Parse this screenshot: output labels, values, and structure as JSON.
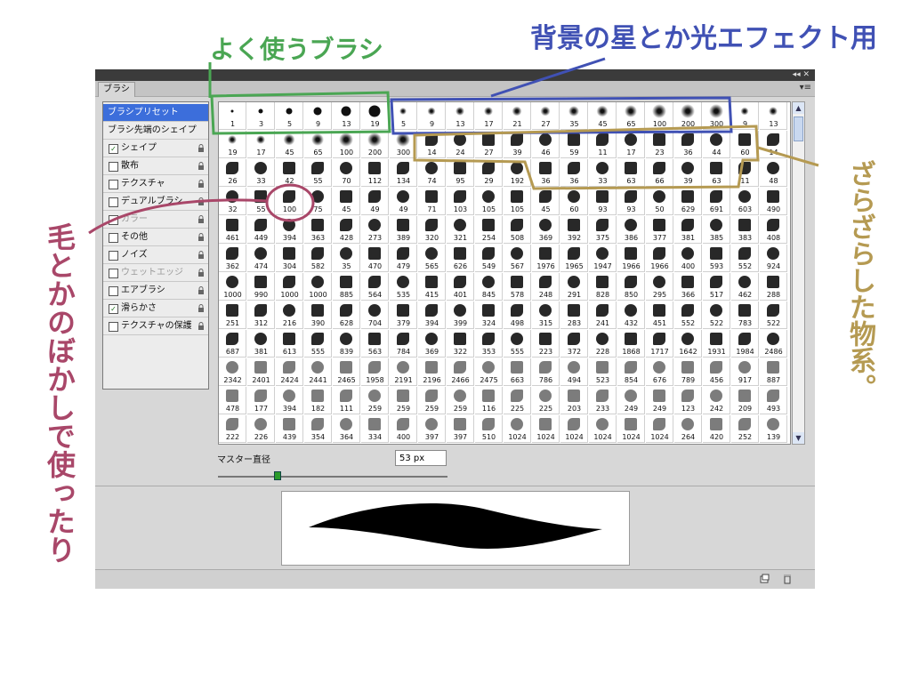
{
  "panel": {
    "tab_label": "ブラシ",
    "title_controls": "◂◂ ✕",
    "panel_menu": "▾≡"
  },
  "sidebar": {
    "items": [
      {
        "label": "ブラシプリセット",
        "kind": "selected"
      },
      {
        "label": "ブラシ先端のシェイプ",
        "kind": "head"
      },
      {
        "label": "シェイプ",
        "checked": true,
        "lock": true
      },
      {
        "label": "散布",
        "checked": false,
        "lock": true
      },
      {
        "label": "テクスチャ",
        "checked": false,
        "lock": true
      },
      {
        "label": "デュアルブラシ",
        "checked": false,
        "lock": true
      },
      {
        "label": "カラー",
        "checked": false,
        "lock": true,
        "disabled": true
      },
      {
        "label": "その他",
        "checked": false,
        "lock": true
      },
      {
        "label": "ノイズ",
        "checked": false,
        "lock": true
      },
      {
        "label": "ウェットエッジ",
        "checked": false,
        "lock": true,
        "disabled": true
      },
      {
        "label": "エアブラシ",
        "checked": false,
        "lock": true
      },
      {
        "label": "滑らかさ",
        "checked": true,
        "lock": true
      },
      {
        "label": "テクスチャの保護",
        "checked": false,
        "lock": true
      }
    ]
  },
  "brush_rows": [
    [
      "1",
      "3",
      "5",
      "9",
      "13",
      "19",
      "5",
      "9",
      "13",
      "17",
      "21",
      "27",
      "35",
      "45",
      "65",
      "100",
      "200",
      "300",
      "9",
      "13"
    ],
    [
      "19",
      "17",
      "45",
      "65",
      "100",
      "200",
      "300",
      "14",
      "24",
      "27",
      "39",
      "46",
      "59",
      "11",
      "17",
      "23",
      "36",
      "44",
      "60",
      "14"
    ],
    [
      "26",
      "33",
      "42",
      "55",
      "70",
      "112",
      "134",
      "74",
      "95",
      "29",
      "192",
      "36",
      "36",
      "33",
      "63",
      "66",
      "39",
      "63",
      "11",
      "48"
    ],
    [
      "32",
      "55",
      "100",
      "75",
      "45",
      "49",
      "49",
      "71",
      "103",
      "105",
      "105",
      "45",
      "60",
      "93",
      "93",
      "50",
      "629",
      "691",
      "603",
      "490"
    ],
    [
      "461",
      "449",
      "394",
      "363",
      "428",
      "273",
      "389",
      "320",
      "321",
      "254",
      "508",
      "369",
      "392",
      "375",
      "386",
      "377",
      "381",
      "385",
      "383",
      "408"
    ],
    [
      "362",
      "474",
      "304",
      "582",
      "35",
      "470",
      "479",
      "565",
      "626",
      "549",
      "567",
      "1976",
      "1965",
      "1947",
      "1966",
      "1966",
      "400",
      "593",
      "552",
      "924"
    ],
    [
      "1000",
      "990",
      "1000",
      "1000",
      "885",
      "564",
      "535",
      "415",
      "401",
      "845",
      "578",
      "248",
      "291",
      "828",
      "850",
      "295",
      "366",
      "517",
      "462",
      "288"
    ],
    [
      "251",
      "312",
      "216",
      "390",
      "628",
      "704",
      "379",
      "394",
      "399",
      "324",
      "498",
      "315",
      "283",
      "241",
      "432",
      "451",
      "552",
      "522",
      "783",
      "522"
    ],
    [
      "687",
      "381",
      "613",
      "555",
      "839",
      "563",
      "784",
      "369",
      "322",
      "353",
      "555",
      "223",
      "372",
      "228",
      "1868",
      "1717",
      "1642",
      "1931",
      "1984",
      "2486"
    ],
    [
      "2342",
      "2401",
      "2424",
      "2441",
      "2465",
      "1958",
      "2191",
      "2196",
      "2466",
      "2475",
      "663",
      "786",
      "494",
      "523",
      "854",
      "676",
      "789",
      "456",
      "917",
      "887"
    ],
    [
      "478",
      "177",
      "394",
      "182",
      "111",
      "259",
      "259",
      "259",
      "259",
      "116",
      "225",
      "225",
      "203",
      "233",
      "249",
      "249",
      "123",
      "242",
      "209",
      "493"
    ],
    [
      "222",
      "226",
      "439",
      "354",
      "364",
      "334",
      "400",
      "397",
      "397",
      "510",
      "1024",
      "1024",
      "1024",
      "1024",
      "1024",
      "1024",
      "264",
      "420",
      "252",
      "139"
    ]
  ],
  "master": {
    "label": "マスター直径",
    "value": "53 px",
    "slider_fraction": 0.26
  },
  "scroll": {
    "up": "▲",
    "down": "▼"
  },
  "annotations": {
    "green": "よく使うブラシ",
    "blue": "背景の星とか光エフェクト用",
    "tan": "ざらざらした物系。",
    "pink": "毛とかのぼかしで使ったり"
  },
  "colors": {
    "selected": "#3c6edb",
    "green_anno": "#4aa653",
    "blue_anno": "#4051b4",
    "tan_anno": "#b59a52",
    "pink_anno": "#a94769"
  }
}
